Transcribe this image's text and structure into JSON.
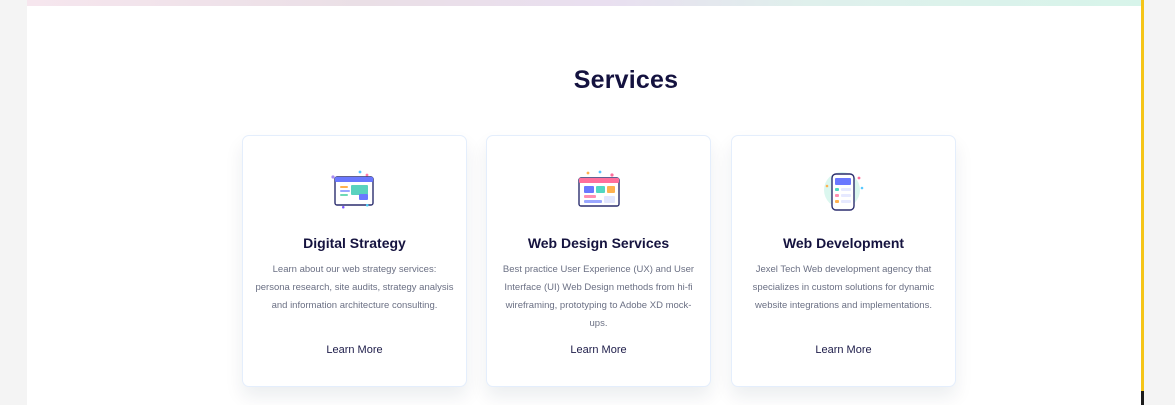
{
  "section": {
    "title": "Services"
  },
  "cards": [
    {
      "title": "Digital Strategy",
      "description": "Learn about our web strategy services: persona research, site audits, strategy analysis and information architecture consulting.",
      "link": "Learn More",
      "icon": "strategy-dashboard-icon"
    },
    {
      "title": "Web Design Services",
      "description": "Best practice User Experience (UX) and User Interface (UI) Web Design methods from hi-fi wireframing, prototyping to Adobe XD mock-ups.",
      "link": "Learn More",
      "icon": "web-design-layout-icon"
    },
    {
      "title": "Web Development",
      "description": "Jexel Tech Web development agency that specializes in custom solutions for dynamic website integrations and implementations.",
      "link": "Learn More",
      "icon": "mobile-development-icon"
    }
  ],
  "colors": {
    "heading": "#14123f",
    "body_text": "#6b7084",
    "accent": "#f5c518",
    "card_border": "#e4eefc"
  }
}
